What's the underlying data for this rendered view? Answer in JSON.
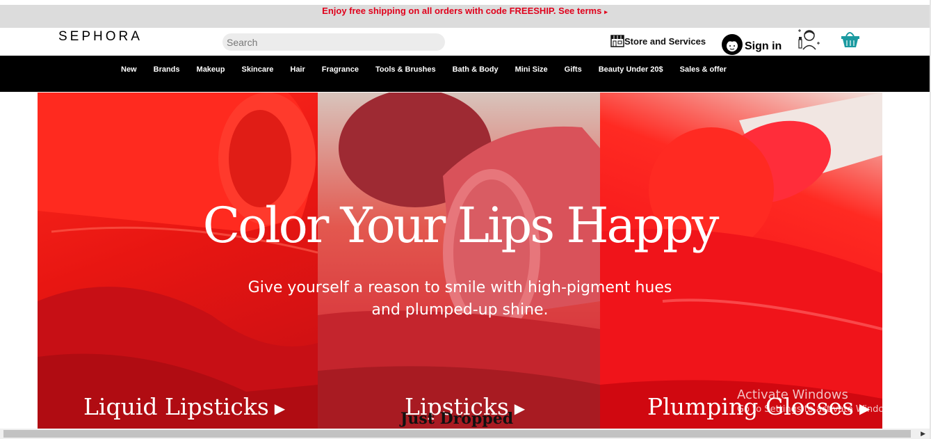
{
  "promo": {
    "text": "Enjoy free shipping on all orders with code FREESHIP. See terms",
    "arrow": "▸"
  },
  "header": {
    "logo": "SEPHORA",
    "search_placeholder": "Search",
    "store_label": "Store and Services",
    "signin_label": "Sign in"
  },
  "nav": {
    "items": [
      "New",
      "Brands",
      "Makeup",
      "Skincare",
      "Hair",
      "Fragrance",
      "Tools & Brushes",
      "Bath & Body",
      "Mini Size",
      "Gifts",
      "Beauty Under 20$",
      "Sales & offer"
    ]
  },
  "hero": {
    "title": "Color Your Lips Happy",
    "subtitle_line1": "Give yourself a reason to smile with high-pigment hues",
    "subtitle_line2": "and plumped-up shine.",
    "cta1": "Liquid Lipsticks",
    "cta2": "Lipsticks",
    "cta3": "Plumping Glosses"
  },
  "section": {
    "just_dropped": "Just Dropped"
  },
  "watermark": {
    "line1": "Activate Windows",
    "line2": "Go to Settings to activate Windows."
  },
  "icons": [
    "store-icon",
    "user-avatar-icon",
    "beauty-advisor-icon",
    "basket-icon",
    "triangle-right-icon"
  ],
  "colors": {
    "promo_text": "#e0001b",
    "nav_bg": "#000000",
    "promo_bg": "#dcdcdc",
    "basket": "#1a9aa0"
  }
}
